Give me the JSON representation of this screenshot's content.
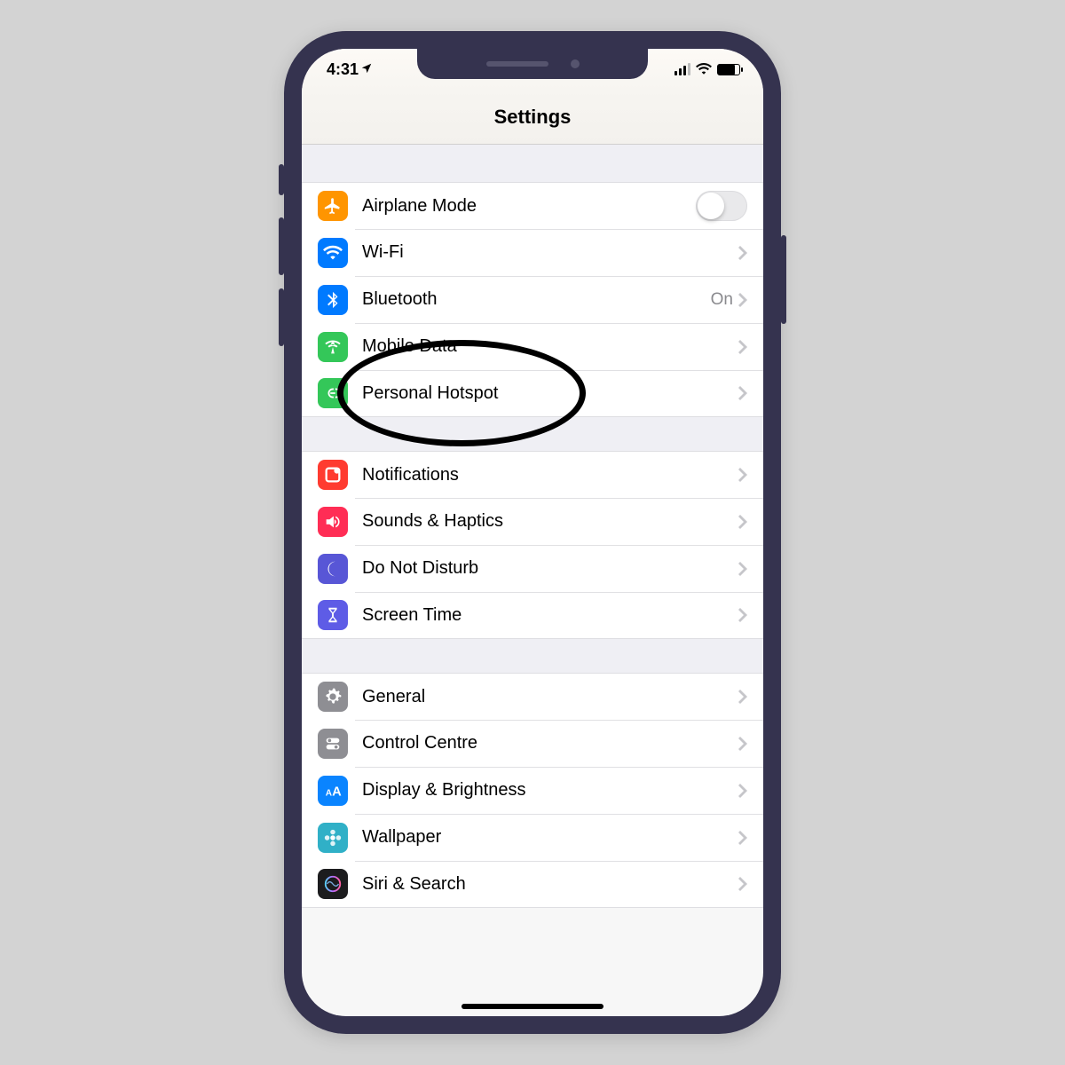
{
  "status": {
    "time": "4:31"
  },
  "header": {
    "title": "Settings"
  },
  "groups": [
    {
      "rows": [
        {
          "id": "airplane",
          "label": "Airplane Mode",
          "icon": "airplane-icon",
          "icon_bg": "bg-orange",
          "kind": "toggle",
          "toggled": false
        },
        {
          "id": "wifi",
          "label": "Wi-Fi",
          "icon": "wifi-icon",
          "icon_bg": "bg-blue",
          "kind": "nav",
          "detail": ""
        },
        {
          "id": "bluetooth",
          "label": "Bluetooth",
          "icon": "bluetooth-icon",
          "icon_bg": "bg-blue",
          "kind": "nav",
          "detail": "On"
        },
        {
          "id": "mobile",
          "label": "Mobile Data",
          "icon": "antenna-icon",
          "icon_bg": "bg-green",
          "kind": "nav",
          "detail": ""
        },
        {
          "id": "hotspot",
          "label": "Personal Hotspot",
          "icon": "hotspot-icon",
          "icon_bg": "bg-green",
          "kind": "nav",
          "detail": ""
        }
      ]
    },
    {
      "rows": [
        {
          "id": "notifications",
          "label": "Notifications",
          "icon": "notifications-icon",
          "icon_bg": "bg-red",
          "kind": "nav",
          "detail": ""
        },
        {
          "id": "sounds",
          "label": "Sounds & Haptics",
          "icon": "speaker-icon",
          "icon_bg": "bg-pink",
          "kind": "nav",
          "detail": ""
        },
        {
          "id": "dnd",
          "label": "Do Not Disturb",
          "icon": "moon-icon",
          "icon_bg": "bg-purple",
          "kind": "nav",
          "detail": ""
        },
        {
          "id": "screentime",
          "label": "Screen Time",
          "icon": "hourglass-icon",
          "icon_bg": "bg-indigo",
          "kind": "nav",
          "detail": ""
        }
      ]
    },
    {
      "rows": [
        {
          "id": "general",
          "label": "General",
          "icon": "gear-icon",
          "icon_bg": "bg-gray",
          "kind": "nav",
          "detail": ""
        },
        {
          "id": "control",
          "label": "Control Centre",
          "icon": "switches-icon",
          "icon_bg": "bg-gray",
          "kind": "nav",
          "detail": ""
        },
        {
          "id": "display",
          "label": "Display & Brightness",
          "icon": "textsize-icon",
          "icon_bg": "bg-bluealt",
          "kind": "nav",
          "detail": ""
        },
        {
          "id": "wallpaper",
          "label": "Wallpaper",
          "icon": "flower-icon",
          "icon_bg": "bg-teal",
          "kind": "nav",
          "detail": ""
        },
        {
          "id": "siri",
          "label": "Siri & Search",
          "icon": "siri-icon",
          "icon_bg": "bg-grad",
          "kind": "nav",
          "detail": ""
        }
      ]
    }
  ],
  "annotation": {
    "target_row_id": "hotspot",
    "shape": "ellipse"
  }
}
